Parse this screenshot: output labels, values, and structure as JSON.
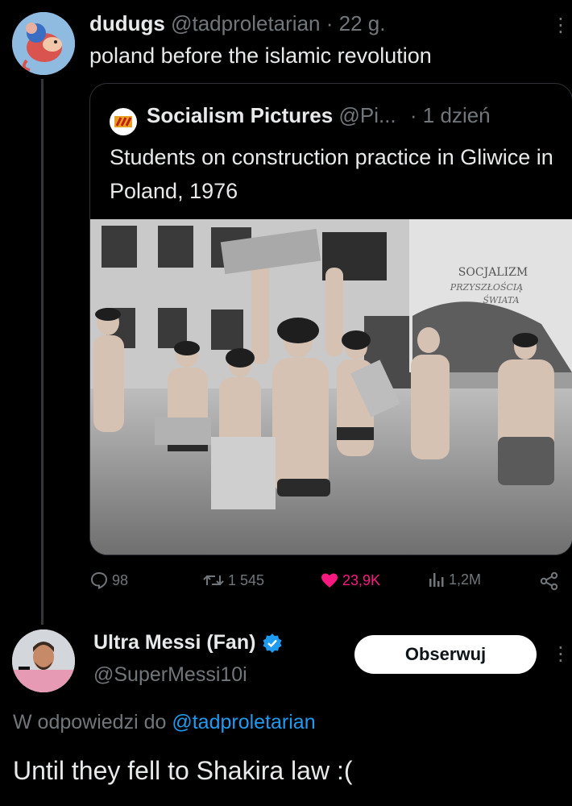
{
  "post": {
    "author_name": "dudugs",
    "author_handle": "@tadproletarian",
    "separator": "·",
    "time": "22 g.",
    "text": "poland before the islamic revolution",
    "more_icon": "more-vertical-icon"
  },
  "quote": {
    "author_name": "Socialism Pictures",
    "author_handle": "@Pi...",
    "separator": "·",
    "time": "1 dzień",
    "text": "Students on construction practice in Gliwice in Poland, 1976",
    "photo_sign_lines": [
      "SOCJALIZM",
      "PRZYSZŁOŚCIĄ",
      "ŚWIATA"
    ]
  },
  "actions": {
    "replies": "98",
    "reposts": "1 545",
    "likes": "23,9K",
    "views": "1,2M",
    "like_color": "#f91880"
  },
  "reply": {
    "author_name": "Ultra Messi (Fan)",
    "author_handle": "@SuperMessi10i",
    "follow_label": "Obserwuj",
    "reply_prefix": "W odpowiedzi do",
    "reply_to": "@tadproletarian",
    "text": "Until they fell to Shakira law :(",
    "verified_color": "#1d9bf0"
  }
}
